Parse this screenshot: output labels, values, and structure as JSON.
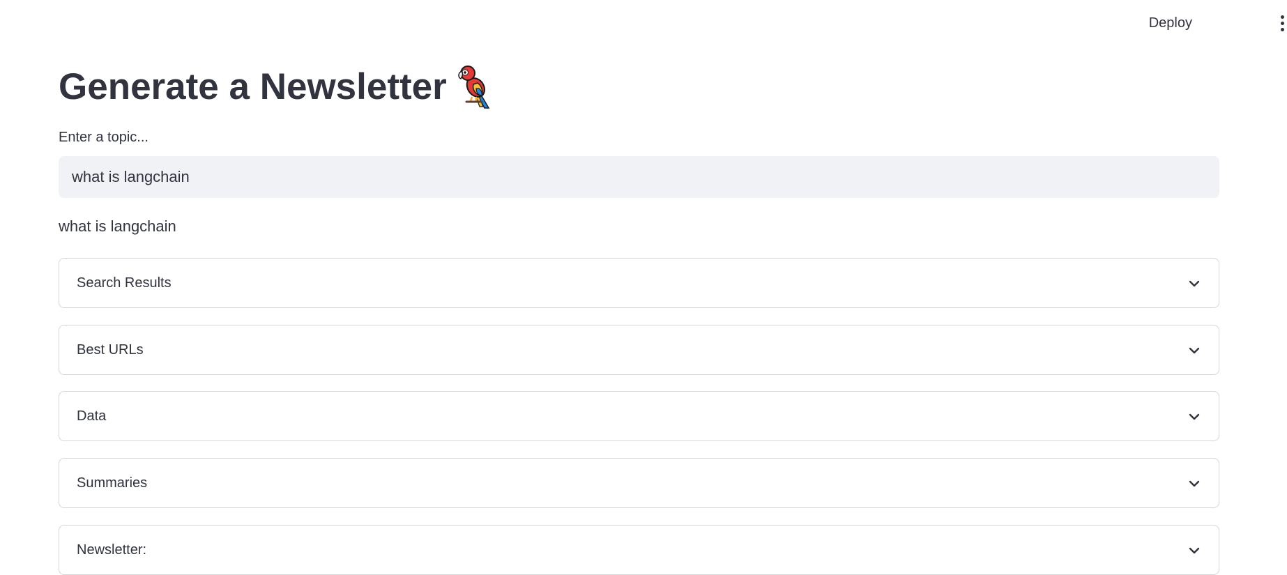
{
  "header": {
    "deploy_label": "Deploy",
    "menu_icon": "vertical-ellipsis-icon"
  },
  "page": {
    "title": "Generate a Newsletter",
    "title_emoji": "parrot-icon"
  },
  "topic_input": {
    "label": "Enter a topic...",
    "value": "what is langchain"
  },
  "echo": "what is langchain",
  "expanders": [
    {
      "label": "Search Results"
    },
    {
      "label": "Best URLs"
    },
    {
      "label": "Data"
    },
    {
      "label": "Summaries"
    },
    {
      "label": "Newsletter:"
    }
  ],
  "colors": {
    "text": "#31333f",
    "input_bg": "#f0f2f6",
    "border": "#d6d6d9"
  }
}
